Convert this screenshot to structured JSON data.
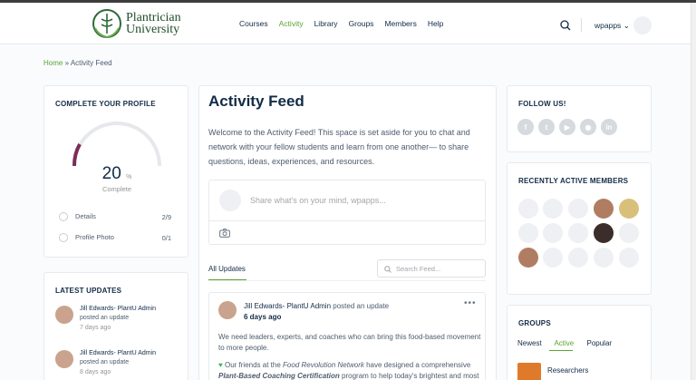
{
  "site": {
    "logo_text_1": "Plantrician",
    "logo_text_2": "University",
    "nav": [
      "Courses",
      "Activity",
      "Library",
      "Groups",
      "Members",
      "Help"
    ],
    "nav_active": "Activity",
    "user_name": "wpapps",
    "accent": "#5aa531"
  },
  "breadcrumb": {
    "home": "Home",
    "sep": "»",
    "current": "Activity Feed"
  },
  "profile": {
    "title": "Complete Your Profile",
    "percent": "20",
    "percent_sign": "%",
    "complete_label": "Complete",
    "rows": [
      {
        "label": "Details",
        "count": "2/9"
      },
      {
        "label": "Profile Photo",
        "count": "0/1"
      }
    ]
  },
  "updates": {
    "title": "Latest Updates",
    "items": [
      {
        "name": "Jill Edwards- PlantU Admin",
        "action": "posted an update",
        "time": "7 days ago"
      },
      {
        "name": "Jill Edwards- PlantU Admin",
        "action": "posted an update",
        "time": "8 days ago"
      }
    ]
  },
  "feed": {
    "title": "Activity Feed",
    "intro": "Welcome to the Activity Feed! This space is set aside for you to chat and network with your fellow students and learn from one another— to share questions, ideas, experiences, and resources.",
    "whatsnew_placeholder": "Share what's on your mind, wpapps...",
    "tab_all": "All Updates",
    "search_placeholder": "Search Feed...",
    "post": {
      "author": "Jill Edwards- PlantU Admin",
      "action": "posted an update",
      "time": "6 days ago",
      "body1": "We need leaders, experts, and coaches who can bring this food-based movement to more people.",
      "body2_a": "Our friends at the",
      "body2_b": "Food Revolution Network",
      "body2_c": "have designed a comprehensive",
      "body2_d": "Plant-Based Coaching Certification",
      "body2_e": "program to help today's brightest and most"
    }
  },
  "follow": {
    "title": "Follow Us!",
    "icons": [
      "facebook-icon",
      "twitter-icon",
      "youtube-icon",
      "instagram-icon",
      "linkedin-icon"
    ]
  },
  "members": {
    "title": "Recently Active Members"
  },
  "groups": {
    "title": "Groups",
    "tabs": [
      "Newest",
      "Active",
      "Popular"
    ],
    "active_tab": "Active",
    "first_group": "Researchers"
  }
}
